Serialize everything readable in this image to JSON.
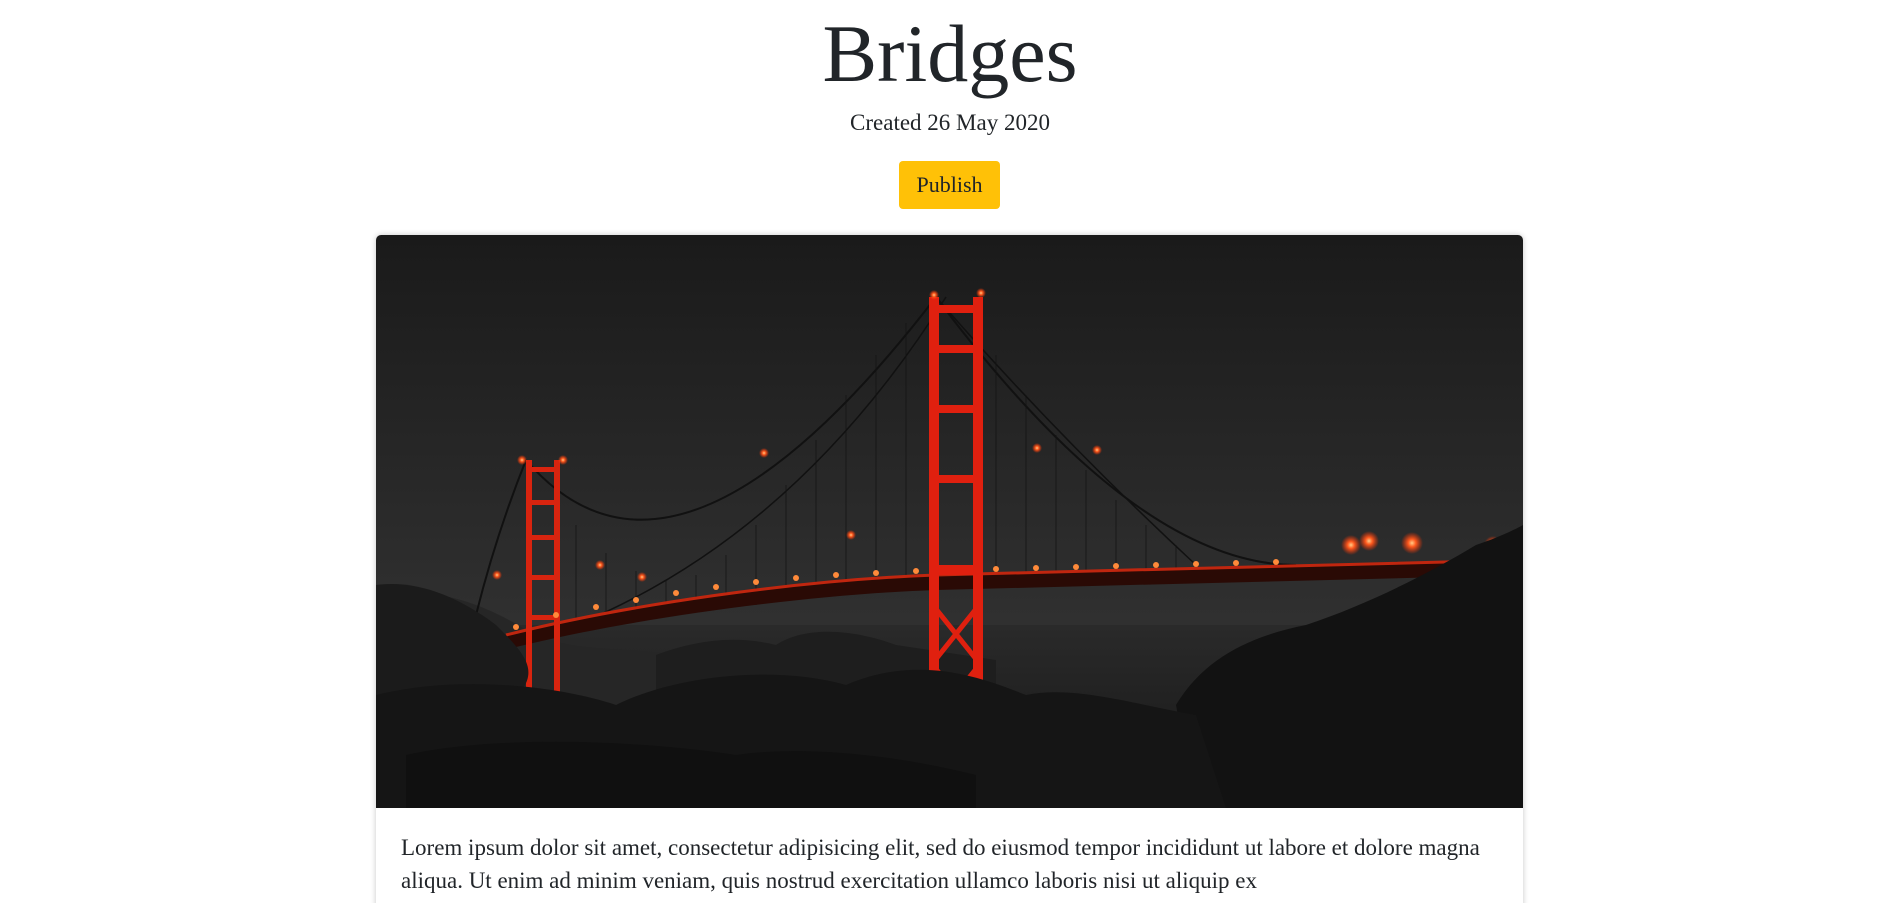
{
  "post": {
    "title": "Bridges",
    "created": "Created 26 May 2020",
    "publish_label": "Publish",
    "body": "Lorem ipsum dolor sit amet, consectetur adipisicing elit, sed do eiusmod tempor incididunt ut labore et dolore magna aliqua. Ut enim ad minim veniam, quis nostrud exercitation ullamco laboris nisi ut aliquip ex"
  },
  "colors": {
    "publish_bg": "#ffc107",
    "text": "#212529",
    "bridge_red": "#e0200f"
  }
}
